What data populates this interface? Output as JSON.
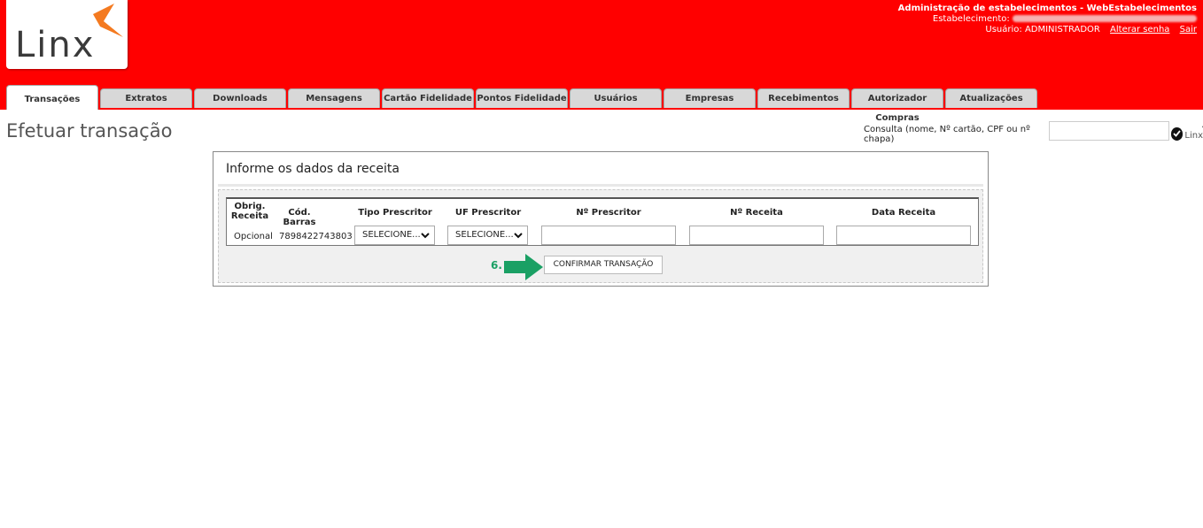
{
  "brand": {
    "logo_text": "Linx",
    "accent": "#ff0000",
    "logo_orange": "#f47a20"
  },
  "header": {
    "admin_title": "Administração de estabelecimentos - WebEstabelecimentos",
    "estabelecimento_label": "Estabelecimento:",
    "usuario_label": "Usuário: ADMINISTRADOR",
    "alterar_senha": "Alterar senha",
    "sair": "Sair"
  },
  "tabs": [
    {
      "label": "Transações",
      "active": true
    },
    {
      "label": "Extratos"
    },
    {
      "label": "Downloads"
    },
    {
      "label": "Mensagens"
    },
    {
      "label": "Cartão Fidelidade"
    },
    {
      "label": "Pontos Fidelidade"
    },
    {
      "label": "Usuários"
    },
    {
      "label": "Empresas"
    },
    {
      "label": "Recebimentos"
    },
    {
      "label": "Autorizador Compras"
    },
    {
      "label": "Atualizações"
    }
  ],
  "page_title": "Efetuar transação",
  "consulta": {
    "label": "Consulta (nome, Nº cartão, CPF ou nº chapa)",
    "value": "",
    "mini_logo": "Linx"
  },
  "panel": {
    "title": "Informe os dados da receita",
    "columns": [
      "Obrig. Receita",
      "Cód. Barras",
      "Tipo Prescritor",
      "UF Prescritor",
      "Nº Prescritor",
      "Nº Receita",
      "Data Receita"
    ],
    "row": {
      "obrig": "Opcional",
      "cod_barras": "7898422743803",
      "tipo_prescritor": "SELECIONE...",
      "uf_prescritor": "SELECIONE...",
      "n_prescritor": "",
      "n_receita": "",
      "data_receita": ""
    },
    "step_label": "6.",
    "confirm_label": "CONFIRMAR TRANSAÇÃO"
  }
}
